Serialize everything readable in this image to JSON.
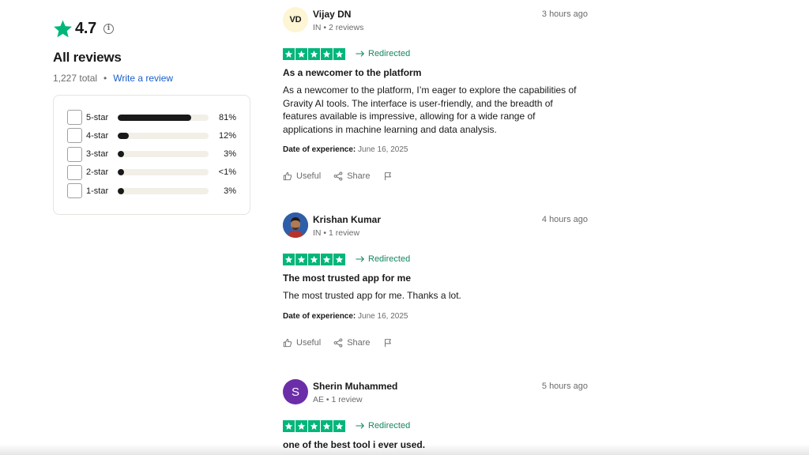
{
  "summary": {
    "rating": "4.7",
    "info_glyph": "i",
    "heading": "All reviews",
    "total": "1,227 total",
    "separator": "•",
    "write_review": "Write a review",
    "accent_color": "#00b67a",
    "distribution": [
      {
        "label": "5-star",
        "percent_text": "81%",
        "fill_percent": 81
      },
      {
        "label": "4-star",
        "percent_text": "12%",
        "fill_percent": 12
      },
      {
        "label": "3-star",
        "percent_text": "3%",
        "fill_percent": 3
      },
      {
        "label": "2-star",
        "percent_text": "<1%",
        "fill_percent": 1
      },
      {
        "label": "1-star",
        "percent_text": "3%",
        "fill_percent": 3
      }
    ]
  },
  "reviews": [
    {
      "avatar_initials": "VD",
      "name": "Vijay DN",
      "meta": "IN • 2 reviews",
      "time": "3 hours ago",
      "rating": 5,
      "redirected": "Redirected",
      "title": "As a newcomer to the platform",
      "body": "As a newcomer to the platform, I’m eager to explore the capabilities of Gravity AI tools. The interface is user-friendly, and the breadth of features available is impressive, allowing for a wide range of applications in machine learning and data analysis.",
      "doe_label": "Date of experience:",
      "doe_value": "June 16, 2025",
      "useful": "Useful",
      "share": "Share"
    },
    {
      "avatar_initials": "",
      "name": "Krishan Kumar",
      "meta": "IN • 1 review",
      "time": "4 hours ago",
      "rating": 5,
      "redirected": "Redirected",
      "title": "The most trusted app for me",
      "body": "The most trusted app for me. Thanks a lot.",
      "doe_label": "Date of experience:",
      "doe_value": "June 16, 2025",
      "useful": "Useful",
      "share": "Share"
    },
    {
      "avatar_initials": "S",
      "name": "Sherin Muhammed",
      "meta": "AE • 1 review",
      "time": "5 hours ago",
      "rating": 5,
      "redirected": "Redirected",
      "title": "one of the best tool i ever used."
    }
  ]
}
